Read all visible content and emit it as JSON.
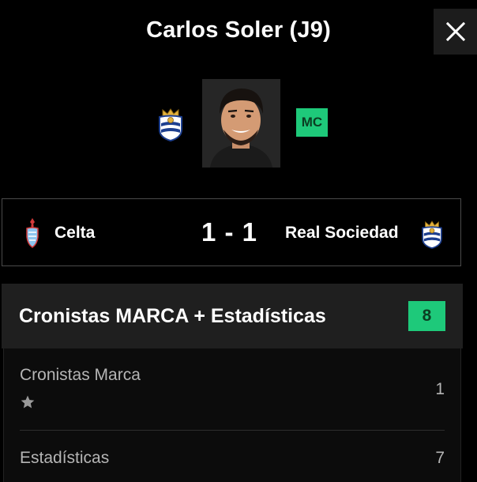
{
  "player": {
    "title": "Carlos Soler (J9)",
    "position": "MC",
    "photo_icon": "player-photo",
    "club_icon": "real-sociedad-crest-icon"
  },
  "close_icon": "close-icon",
  "match": {
    "home_team": "Celta",
    "away_team": "Real Sociedad",
    "score": "1 - 1",
    "home_icon": "celta-crest-icon",
    "away_icon": "real-sociedad-crest-icon"
  },
  "rating": {
    "title": "Cronistas MARCA + Estadísticas",
    "total": "8",
    "rows": [
      {
        "label": "Cronistas Marca",
        "value": "1",
        "icon": "star-icon"
      },
      {
        "label": "Estadísticas",
        "value": "7"
      }
    ]
  },
  "colors": {
    "background": "#000000",
    "accent_green": "#1ec97a",
    "panel": "#1f1f1f",
    "muted_text": "#b5b5b5"
  }
}
